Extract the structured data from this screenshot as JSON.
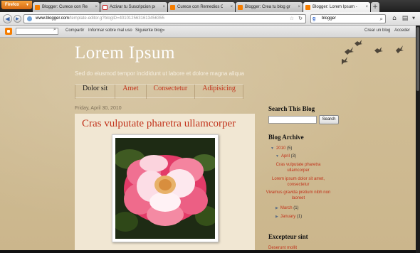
{
  "browser": {
    "menu_button": "Firefox",
    "tabs": [
      {
        "label": "Blogger: Curece con Remedi...",
        "icon": "blogger",
        "active": false
      },
      {
        "label": "Activar tu Suscripcion por e-...",
        "icon": "gmail",
        "active": false
      },
      {
        "label": "Curece con Remedios Caseros",
        "icon": "blogger",
        "active": false
      },
      {
        "label": "Blogger: Crea tu blog gratuito",
        "icon": "blogger",
        "active": false
      },
      {
        "label": "Blogger: Lorem Ipsum - Dise...",
        "icon": "blogger",
        "active": true
      }
    ],
    "new_tab": "+",
    "url_domain": "www.blogger.com",
    "url_path": "/template-editor.g?blogID=4010125631613456355",
    "search_value": "blogger",
    "search_engine_letter": "g"
  },
  "blogger_bar": {
    "links": [
      "Compartir",
      "Informar sobre mal uso",
      "Siguiente blog»"
    ],
    "right_links": [
      "Crear un blog",
      "Acceder"
    ]
  },
  "blog": {
    "title": "Lorem Ipsum",
    "description": "Sed do eiusmod tempor incididunt ut labore et dolore magna aliqua",
    "menu": [
      "Dolor sit",
      "Amet",
      "Consectetur",
      "Adipisicing"
    ],
    "post": {
      "date": "Friday, April 30, 2010",
      "title": "Cras vulputate pharetra ullamcorper"
    }
  },
  "sidebar": {
    "search_title": "Search This Blog",
    "search_button": "Search",
    "archive_title": "Blog Archive",
    "archive": {
      "year": "2010",
      "year_count": "(5)",
      "month": "April",
      "month_count": "(3)",
      "posts": [
        "Cras vulputate pharetra ullamcorper",
        "Lorem ipsum dolor sit amet, consectetur",
        "Vivamus gravida pretium nibh non laoreet"
      ],
      "other_months": [
        {
          "name": "March",
          "count": "(1)"
        },
        {
          "name": "January",
          "count": "(1)"
        }
      ]
    },
    "excepteur_title": "Excepteur sint",
    "excepteur_link": "Deserunt mollit"
  }
}
